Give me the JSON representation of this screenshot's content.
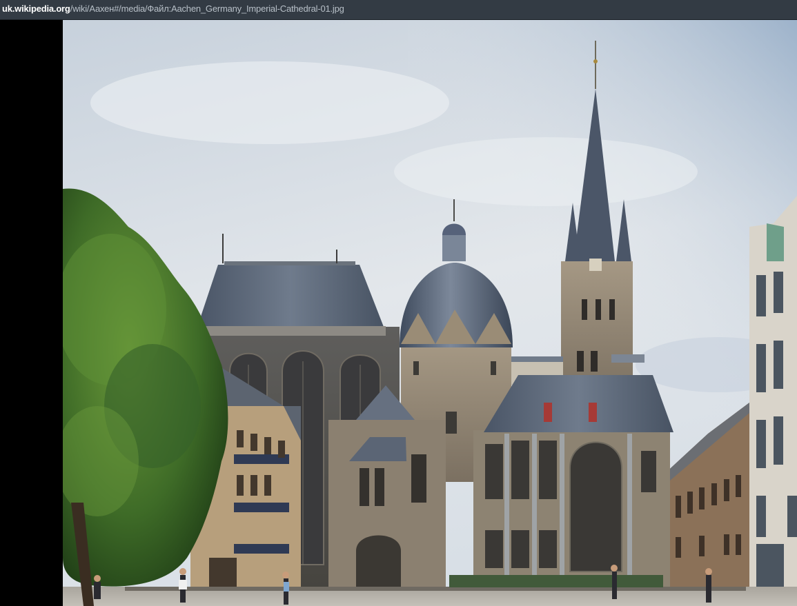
{
  "browser": {
    "url_domain": "uk.wikipedia.org",
    "url_path": "/wiki/Аахен#/media/Файл:Aachen_Germany_Imperial-Cathedral-01.jpg"
  },
  "image": {
    "subject": "Aachen Cathedral photograph",
    "colors": {
      "sky_top": "#c9d3de",
      "sky_bottom": "#e6eaee",
      "stone": "#8f8372",
      "roof": "#55606f",
      "foliage": "#3f6b2a",
      "pavement": "#b7b3aa"
    }
  }
}
